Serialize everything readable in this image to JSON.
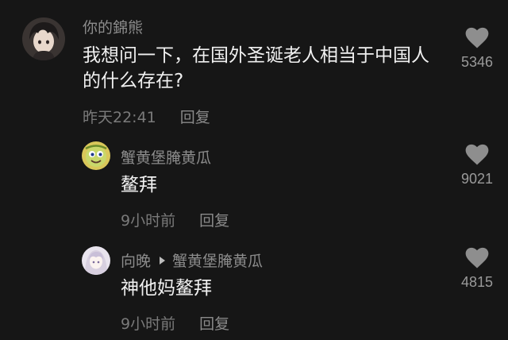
{
  "comments": [
    {
      "username": "你的錦熊",
      "text": "我想问一下，在国外圣诞老人相当于中国人的什么存在?",
      "time": "昨天22:41",
      "reply_label": "回复",
      "likes": "5346",
      "avatar_icon": "anime-boy-avatar"
    },
    {
      "username": "蟹黄堡腌黄瓜",
      "text": "鳌拜",
      "time": "9小时前",
      "reply_label": "回复",
      "likes": "9021",
      "avatar_icon": "cartoon-face-avatar"
    },
    {
      "username": "向晚",
      "reply_to": "蟹黄堡腌黄瓜",
      "text": "神他妈鳌拜",
      "time": "9小时前",
      "reply_label": "回复",
      "likes": "4815",
      "avatar_icon": "anime-girl-avatar"
    }
  ],
  "colors": {
    "background": "#161616",
    "heart": "#8e8e8e"
  }
}
